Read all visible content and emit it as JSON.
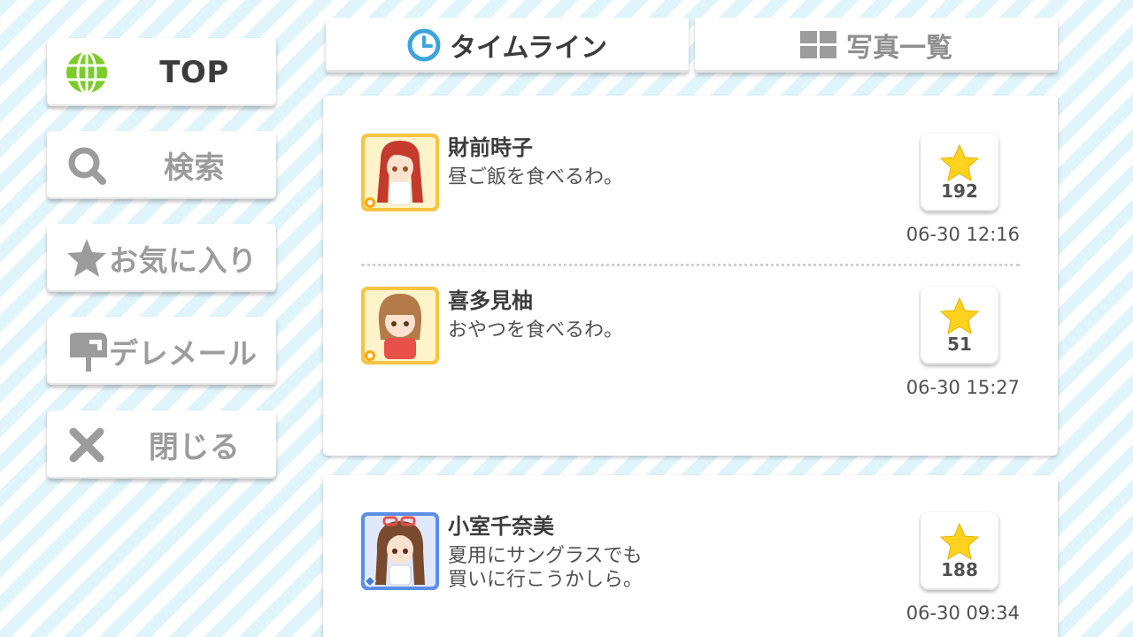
{
  "sidebar": {
    "items": [
      {
        "label": "TOP",
        "icon": "globe-icon",
        "active": true
      },
      {
        "label": "検索",
        "icon": "search-icon"
      },
      {
        "label": "お気に入り",
        "icon": "star-icon"
      },
      {
        "label": "デレメール",
        "icon": "mailbox-icon"
      },
      {
        "label": "閉じる",
        "icon": "close-icon"
      }
    ]
  },
  "tabs": [
    {
      "label": "タイムライン",
      "icon": "clock-icon",
      "active": true
    },
    {
      "label": "写真一覧",
      "icon": "grid-icon",
      "active": false
    }
  ],
  "timeline": {
    "cards": [
      {
        "posts": [
          {
            "name": "財前時子",
            "message": "昼ご飯を食べるわ。",
            "likes": "192",
            "time": "06-30 12:16",
            "frame_color": "#f6c445",
            "badge": "sun-badge"
          },
          {
            "name": "喜多見柚",
            "message": "おやつを食べるわ。",
            "likes": "51",
            "time": "06-30 15:27",
            "frame_color": "#f6c445",
            "badge": "sun-badge"
          }
        ]
      },
      {
        "posts": [
          {
            "name": "小室千奈美",
            "message": "夏用にサングラスでも\n買いに行こうかしら。",
            "likes": "188",
            "time": "06-30 09:34",
            "frame_color": "#5b8fe6",
            "badge": "diamond-badge"
          }
        ]
      }
    ]
  },
  "colors": {
    "stripe": "#dff4fb",
    "globe": "#7ccc2a",
    "clock": "#3fa3db",
    "star": "#ffd21e",
    "icon_gray": "#9c9c9c"
  }
}
